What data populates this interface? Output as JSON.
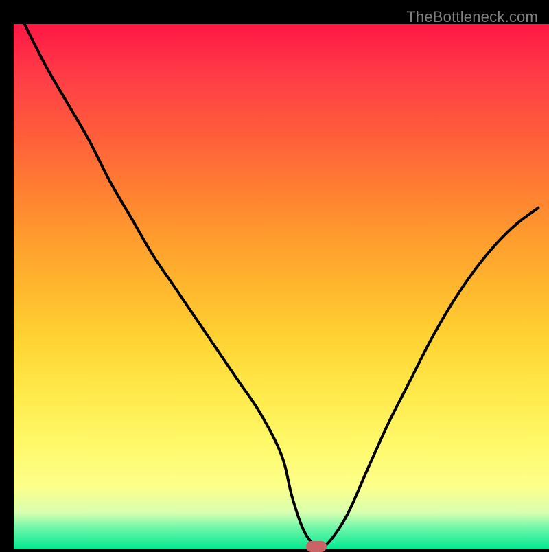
{
  "watermark": "TheBottleneck.com",
  "colors": {
    "line": "#000000",
    "marker": "#c86466",
    "frame": "#000000"
  },
  "chart_data": {
    "type": "line",
    "title": "",
    "xlabel": "",
    "ylabel": "",
    "xlim": [
      0,
      100
    ],
    "ylim": [
      0,
      100
    ],
    "grid": false,
    "legend": false,
    "series": [
      {
        "name": "bottleneck-curve",
        "x": [
          2,
          6,
          10,
          14,
          18,
          22,
          26,
          30,
          34,
          38,
          42,
          46,
          50,
          52,
          54,
          56,
          58,
          62,
          66,
          70,
          74,
          78,
          82,
          86,
          90,
          94,
          98
        ],
        "values": [
          100,
          92,
          85,
          78,
          70,
          63,
          56,
          50,
          44,
          38,
          32,
          26,
          18,
          10,
          4,
          1,
          0.5,
          6,
          15,
          24,
          32,
          40,
          47,
          53,
          58,
          62,
          65
        ]
      }
    ],
    "marker": {
      "x": 56.5,
      "y": 0.5
    }
  }
}
